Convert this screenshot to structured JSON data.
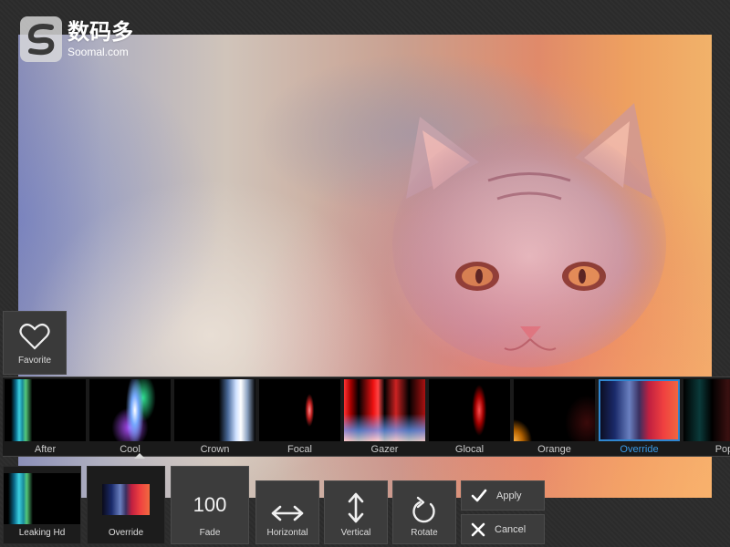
{
  "watermark": {
    "chinese": "数码多",
    "english": "Soomal.com",
    "icon": "soomal-logo-icon"
  },
  "favorite": {
    "label": "Favorite",
    "icon": "heart-outline-icon"
  },
  "effects": [
    {
      "label": "After"
    },
    {
      "label": "Cool"
    },
    {
      "label": "Crown"
    },
    {
      "label": "Focal"
    },
    {
      "label": "Gazer"
    },
    {
      "label": "Glocal"
    },
    {
      "label": "Orange"
    },
    {
      "label": "Override",
      "selected": true
    },
    {
      "label": "Pop"
    }
  ],
  "toolbar": {
    "current_effect": {
      "label": "Leaking Hd"
    },
    "selected_overlay": {
      "label": "Override"
    },
    "fade": {
      "label": "Fade",
      "value": "100"
    },
    "horizontal": {
      "label": "Horizontal",
      "icon": "horizontal-arrows-icon"
    },
    "vertical": {
      "label": "Vertical",
      "icon": "vertical-arrows-icon"
    },
    "rotate": {
      "label": "Rotate",
      "icon": "rotate-icon"
    },
    "apply": {
      "label": "Apply",
      "icon": "checkmark-icon"
    },
    "cancel": {
      "label": "Cancel",
      "icon": "close-icon"
    }
  },
  "colors": {
    "accent": "#2f86d0",
    "panel": "#3c3c3c",
    "background": "#2b2b2b"
  }
}
